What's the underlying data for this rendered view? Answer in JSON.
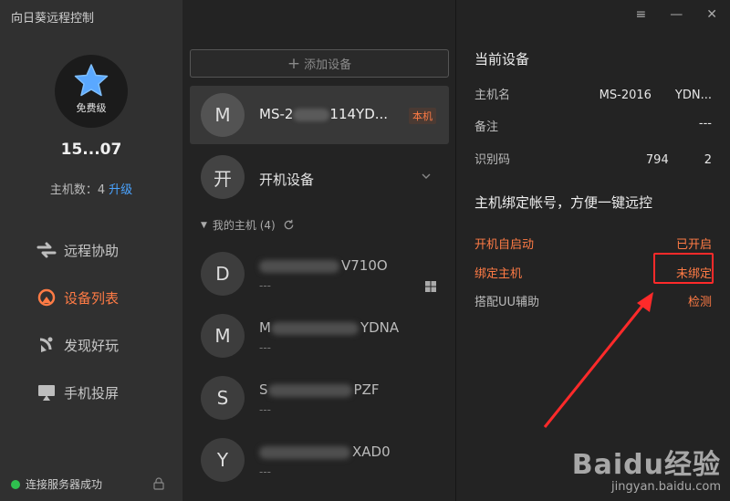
{
  "app": {
    "title": "向日葵远程控制"
  },
  "user": {
    "tier": "免费级",
    "id": "15...07",
    "host_count_label": "主机数：4",
    "upgrade_label": "升级"
  },
  "nav": [
    {
      "label": "远程协助",
      "icon": "remote-assist-icon",
      "active": false
    },
    {
      "label": "设备列表",
      "icon": "device-list-icon",
      "active": true
    },
    {
      "label": "发现好玩",
      "icon": "discover-icon",
      "active": false
    },
    {
      "label": "手机投屏",
      "icon": "screen-cast-icon",
      "active": false
    }
  ],
  "status": {
    "label": "连接服务器成功"
  },
  "list": {
    "add_label": "添加设备",
    "current": {
      "initial": "M",
      "name_prefix": "MS-2",
      "name_suffix": "114YD...",
      "badge": "本机"
    },
    "boot": {
      "initial": "开",
      "label": "开机设备"
    },
    "group": {
      "label": "我的主机 (4)"
    },
    "devices": [
      {
        "initial": "D",
        "name_tail": "V710O",
        "sub": "---"
      },
      {
        "initial": "M",
        "name_head": "M",
        "name_tail": "YDNA",
        "sub": "---"
      },
      {
        "initial": "S",
        "name_head": "S",
        "name_tail": "PZF",
        "sub": "---"
      },
      {
        "initial": "Y",
        "name_tail": "XAD0",
        "sub": "---"
      }
    ]
  },
  "detail": {
    "current_title": "当前设备",
    "rows": [
      {
        "k": "主机名",
        "v": "MS-2016　　YDN..."
      },
      {
        "k": "备注",
        "v": "---"
      },
      {
        "k": "识别码",
        "v": "794　　　2"
      }
    ],
    "bind_title": "主机绑定帐号，方便一键远控",
    "options": [
      {
        "k": "开机自启动",
        "v": "已开启"
      },
      {
        "k": "绑定主机",
        "v": "未绑定"
      },
      {
        "k": "搭配UU辅助",
        "v": "检测"
      }
    ]
  },
  "window_controls": {
    "menu": "≡",
    "minimize": "—",
    "close": "✕"
  },
  "watermark": {
    "logo": "Baidu经验",
    "url": "jingyan.baidu.com"
  },
  "colors": {
    "accent": "#ff7b45",
    "link": "#4aa3ff",
    "online": "#2fc04f",
    "annotation": "#ff2a2a"
  }
}
